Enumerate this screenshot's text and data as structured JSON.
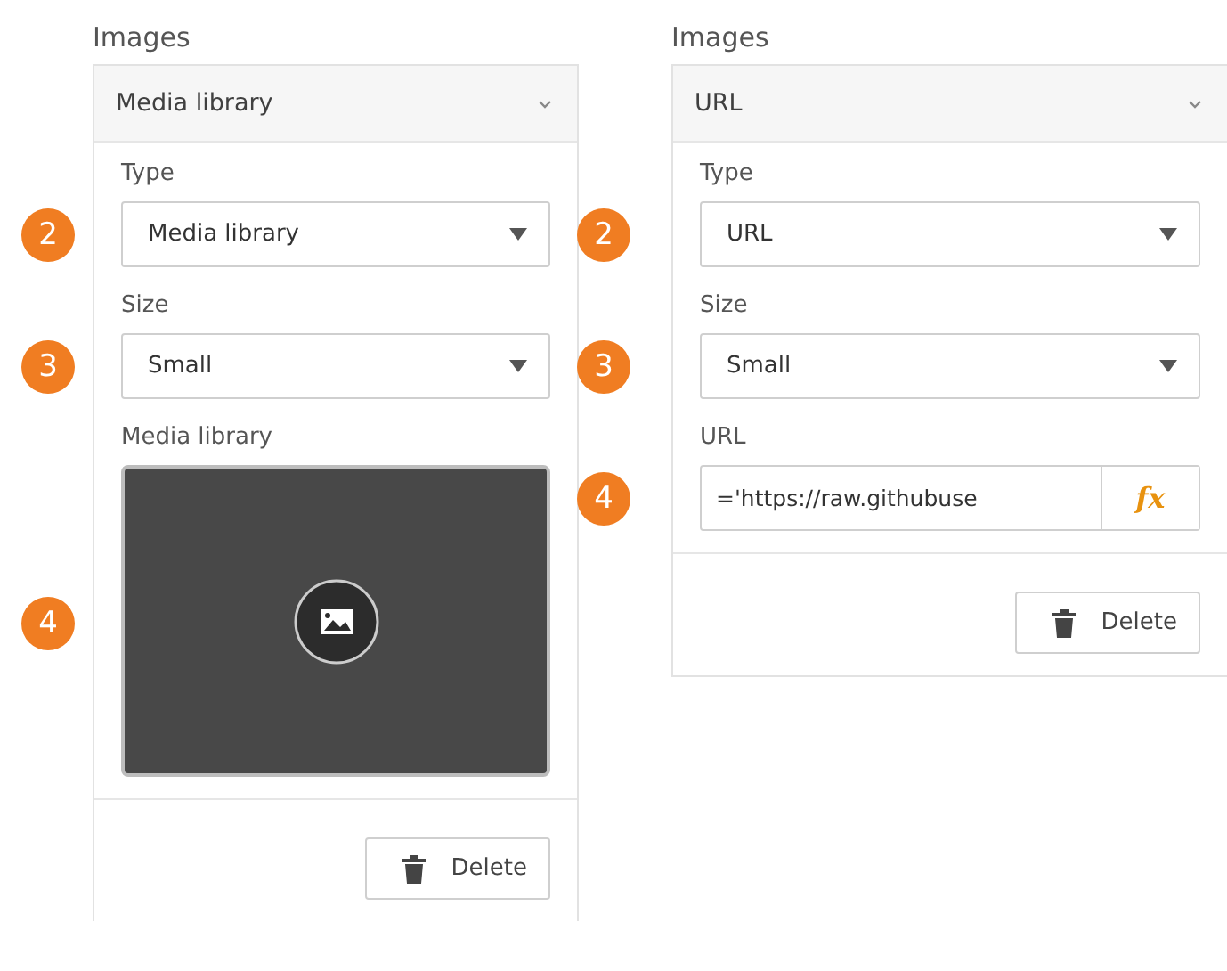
{
  "panels": [
    {
      "title": "Images",
      "header": "Media library",
      "fields": [
        {
          "kind": "select",
          "badge": "2",
          "label": "Type",
          "value": "Media library"
        },
        {
          "kind": "select",
          "badge": "3",
          "label": "Size",
          "value": "Small"
        },
        {
          "kind": "media",
          "badge": "4",
          "label": "Media library"
        }
      ],
      "delete": "Delete"
    },
    {
      "title": "Images",
      "header": "URL",
      "fields": [
        {
          "kind": "select",
          "badge": "2",
          "label": "Type",
          "value": "URL"
        },
        {
          "kind": "select",
          "badge": "3",
          "label": "Size",
          "value": "Small"
        },
        {
          "kind": "url",
          "badge": "4",
          "label": "URL",
          "value": "='https://raw.githubuse",
          "button": "fx"
        }
      ],
      "delete": "Delete"
    }
  ]
}
